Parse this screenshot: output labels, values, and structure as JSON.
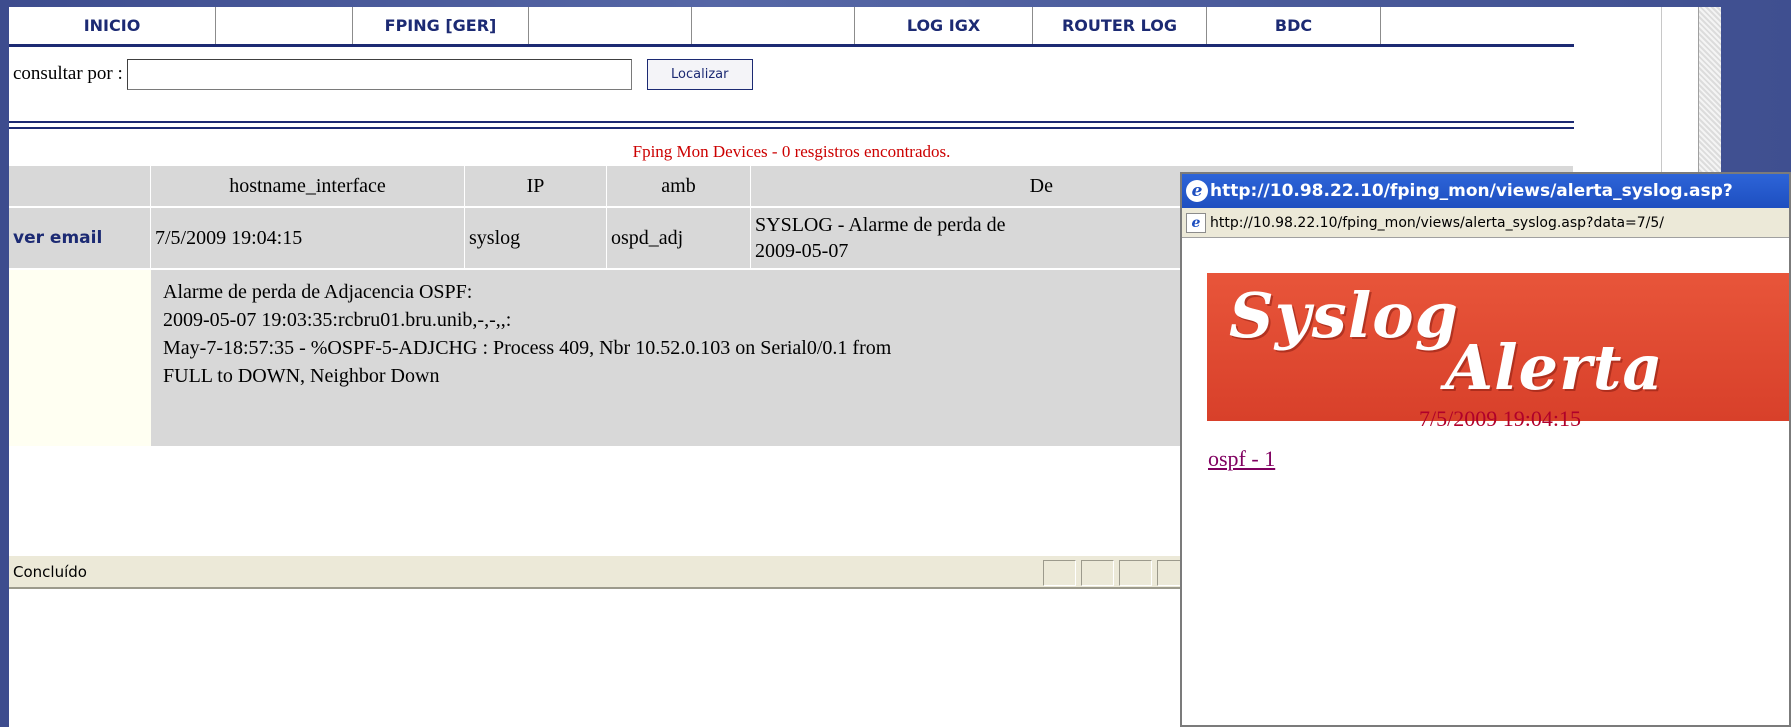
{
  "nav": {
    "items": [
      {
        "label": "INICIO"
      },
      {
        "label": ""
      },
      {
        "label": "FPING [GER]"
      },
      {
        "label": ""
      },
      {
        "label": ""
      },
      {
        "label": "LOG IGX"
      },
      {
        "label": "ROUTER LOG"
      },
      {
        "label": "BDC"
      }
    ]
  },
  "search": {
    "label": "consultar por :",
    "value": "",
    "button": "Localizar"
  },
  "results": {
    "title": "Fping Mon Devices - 0 resgistros encontrados."
  },
  "table": {
    "headers": [
      "",
      "hostname_interface",
      "IP",
      "amb",
      "De"
    ],
    "row": {
      "action": "ver email",
      "hostname": "7/5/2009 19:04:15",
      "ip": "syslog",
      "amb": "ospd_adj",
      "desc_line1": "SYSLOG - Alarme de perda de",
      "desc_line2": "2009-05-07"
    },
    "detail": {
      "line1": "Alarme de perda de Adjacencia OSPF:",
      "line2": "2009-05-07 19:03:35:rcbru01.bru.unib,-,-,,:",
      "line3": "May-7-18:57:35 - %OSPF-5-ADJCHG : Process 409, Nbr 10.52.0.103 on Serial0/0.1 from",
      "line4": "FULL to DOWN, Neighbor Down"
    }
  },
  "statusbar": {
    "text": "Concluído"
  },
  "popup": {
    "title": "http://10.98.22.10/fping_mon/views/alerta_syslog.asp?",
    "address": "http://10.98.22.10/fping_mon/views/alerta_syslog.asp?data=7/5/",
    "banner_word1": "Syslog",
    "banner_word2": "Alerta",
    "date": "7/5/2009 19:04:15",
    "link": "ospf - 1"
  },
  "colors": {
    "nav_text": "#1c2a73",
    "result_title": "#cc0000",
    "banner_bg": "#e04a32",
    "popup_title_bg": "#2d64d8"
  }
}
